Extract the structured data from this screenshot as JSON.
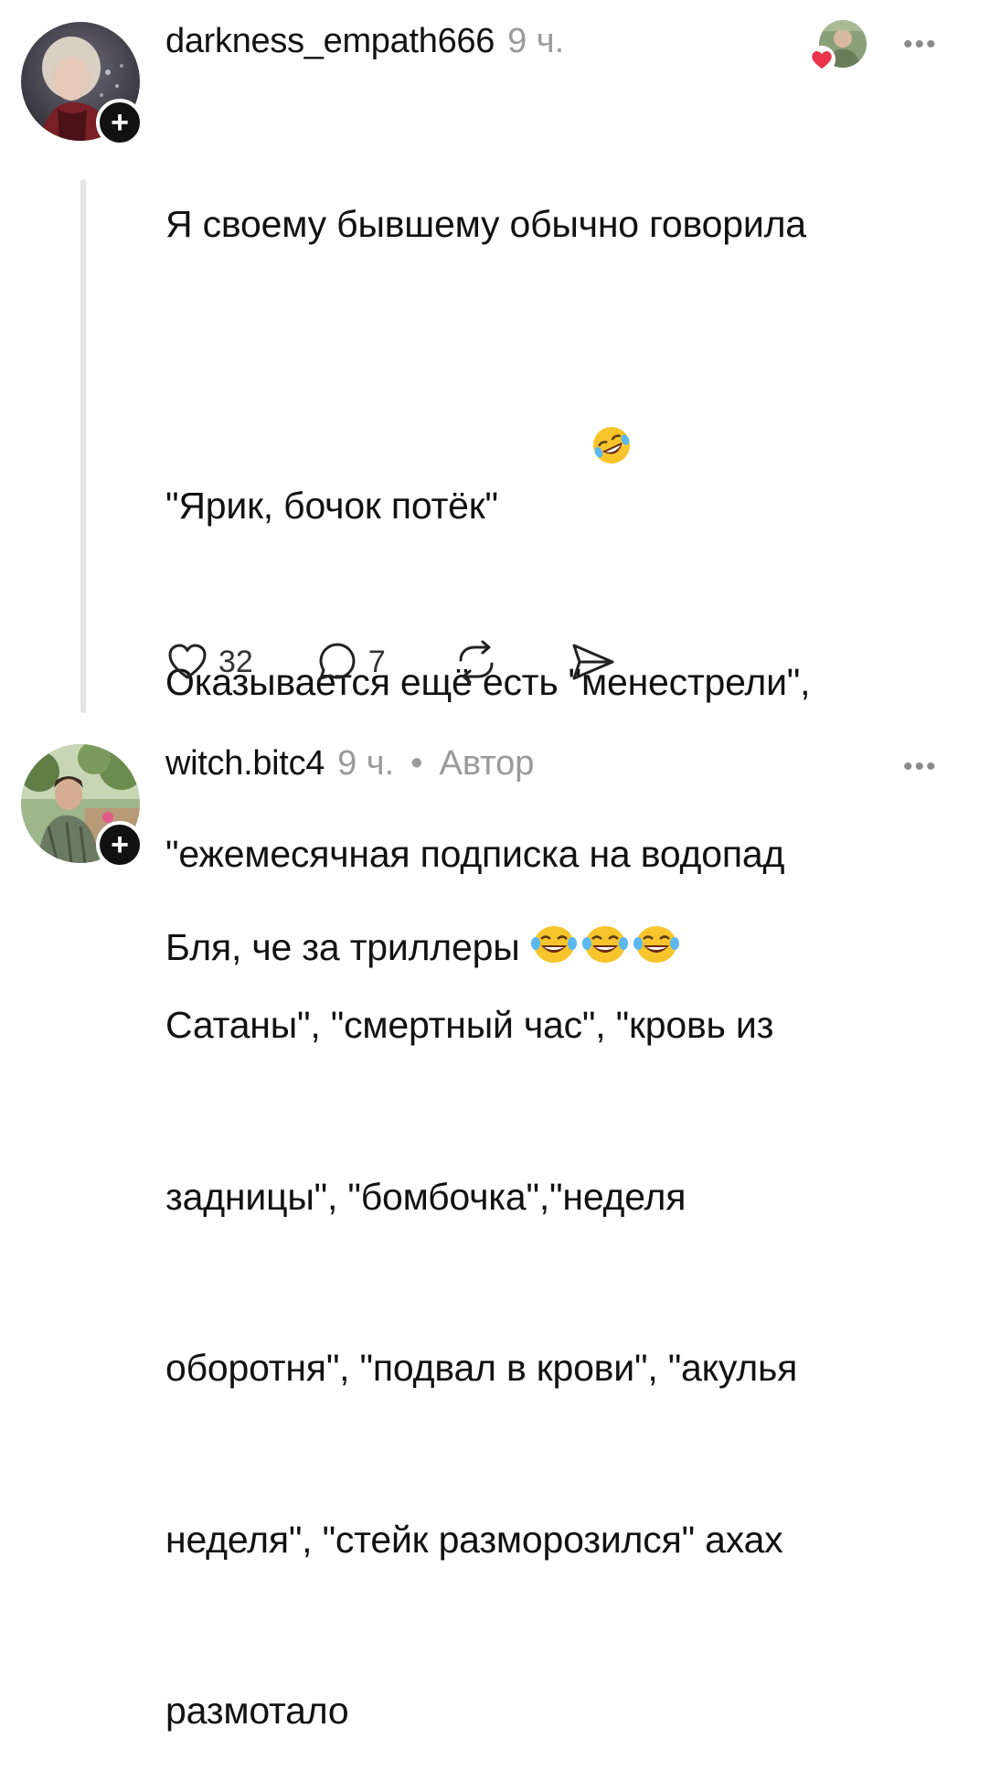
{
  "comments": [
    {
      "username": "darkness_empath666",
      "time": "9 ч.",
      "lines": [
        "Я своему бывшему обычно говорила",
        "\"Ярик, бочок потёк\" ",
        "Оказывается ещё есть \"менестрели\",",
        "\"ежемесячная подписка на водопад",
        "Сатаны\", \"смертный час\", \"кровь из",
        "задницы\", \"бомбочка\",\"неделя",
        "оборотня\", \"подвал в крови\", \"акулья",
        "неделя\", \"стейк разморозился\" ахах",
        "размотало"
      ],
      "emoji": "rolling-on-floor-laughing",
      "likes": "32",
      "replies": "7",
      "follow_symbol": "+",
      "more_symbol": "•••"
    },
    {
      "username": "witch.bitc4",
      "time": "9 ч.",
      "separator": "•",
      "author_label": "Автор",
      "text": "Бля, че за триллеры ",
      "emoji": "face-with-tears-of-joy",
      "emoji_count": 3,
      "follow_symbol": "+",
      "more_symbol": "•••"
    }
  ],
  "colors": {
    "text": "#111111",
    "muted": "#9a9a9a",
    "thread_line": "#e5e5e5",
    "heart": "#e8334a",
    "emoji_yellow": "#f7c52b"
  }
}
